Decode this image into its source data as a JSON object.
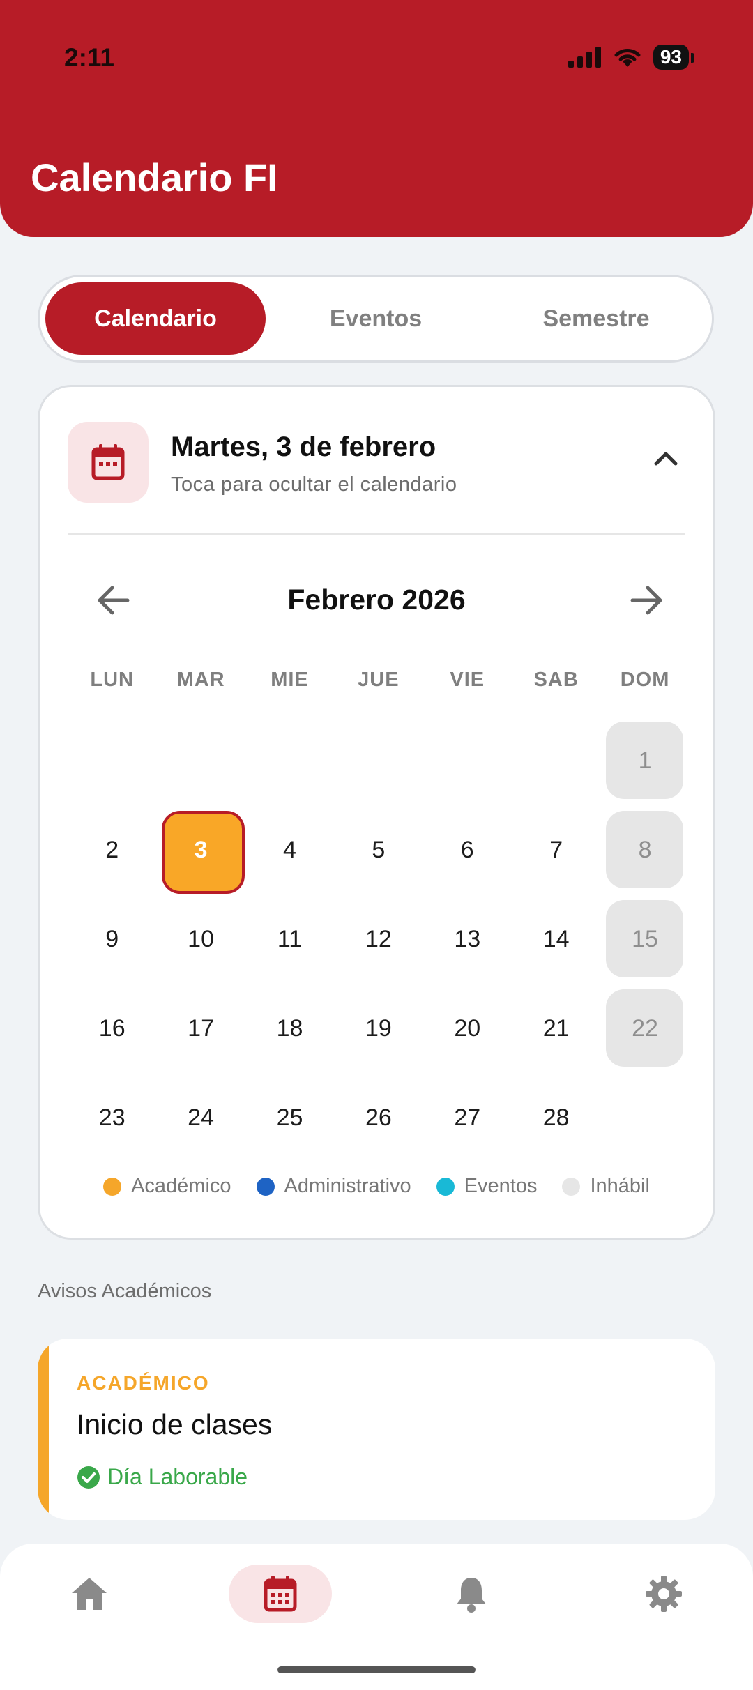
{
  "status_bar": {
    "time": "2:11",
    "battery": "93"
  },
  "header": {
    "title": "Calendario FI"
  },
  "tabs": [
    {
      "label": "Calendario",
      "active": true
    },
    {
      "label": "Eventos",
      "active": false
    },
    {
      "label": "Semestre",
      "active": false
    }
  ],
  "calendar_card": {
    "selected_date": "Martes, 3 de febrero",
    "hint": "Toca para ocultar el calendario",
    "month_label": "Febrero 2026",
    "weekdays": [
      "LUN",
      "MAR",
      "MIE",
      "JUE",
      "VIE",
      "SAB",
      "DOM"
    ],
    "weeks": [
      [
        "",
        "",
        "",
        "",
        "",
        "",
        "1"
      ],
      [
        "2",
        "3",
        "4",
        "5",
        "6",
        "7",
        "8"
      ],
      [
        "9",
        "10",
        "11",
        "12",
        "13",
        "14",
        "15"
      ],
      [
        "16",
        "17",
        "18",
        "19",
        "20",
        "21",
        "22"
      ],
      [
        "23",
        "24",
        "25",
        "26",
        "27",
        "28",
        ""
      ]
    ],
    "selected_day": "3",
    "holiday_days": [
      "1",
      "8",
      "15",
      "22"
    ],
    "legend": [
      {
        "label": "Académico",
        "color": "#f5a62a"
      },
      {
        "label": "Administrativo",
        "color": "#1e63c4"
      },
      {
        "label": "Eventos",
        "color": "#19b9d6"
      },
      {
        "label": "Inhábil",
        "color": "#e6e6e6"
      }
    ]
  },
  "notices": {
    "section_title": "Avisos Académicos",
    "items": [
      {
        "category": "ACADÉMICO",
        "title": "Inicio de clases",
        "status": "Día Laborable",
        "accent": "#f5a62a"
      }
    ]
  },
  "bottom_nav": [
    {
      "icon": "home-icon",
      "active": false
    },
    {
      "icon": "calendar-icon",
      "active": true
    },
    {
      "icon": "bell-icon",
      "active": false
    },
    {
      "icon": "gear-icon",
      "active": false
    }
  ],
  "colors": {
    "brand": "#b71c27",
    "selected": "#f9a727",
    "success": "#3aa84a"
  }
}
